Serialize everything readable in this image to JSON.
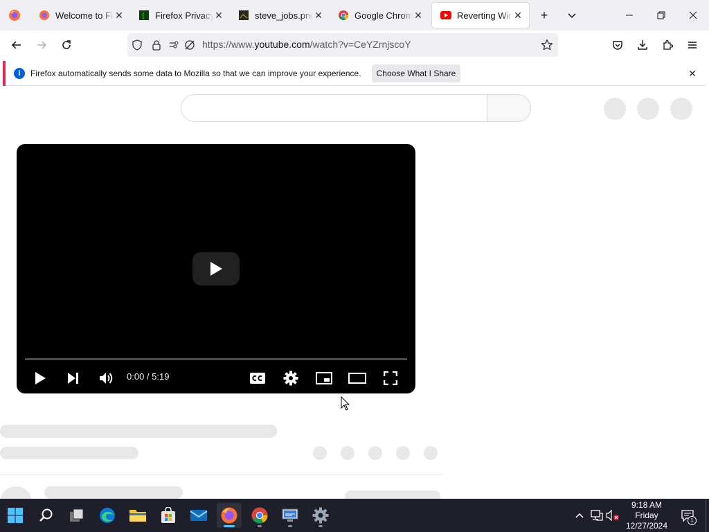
{
  "browser": {
    "tabs": [
      {
        "title": "Welcome to Firefox",
        "active": false
      },
      {
        "title": "Firefox Privacy Notice",
        "active": false
      },
      {
        "title": "steve_jobs.png",
        "active": false
      },
      {
        "title": "Google Chrome",
        "active": false
      },
      {
        "title": "Reverting Windows",
        "active": true
      }
    ],
    "url": {
      "prefix": "https://www.",
      "domain": "youtube.com",
      "path": "/watch?v=CeYZrnjscoY"
    }
  },
  "notification": {
    "message": "Firefox automatically sends some data to Mozilla so that we can improve your experience.",
    "action_label": "Choose What I Share",
    "info_glyph": "i"
  },
  "player": {
    "time": "0:00 / 5:19",
    "progress": 0
  },
  "taskbar": {
    "clock": {
      "time": "9:18 AM",
      "day": "Friday",
      "date": "12/27/2024"
    },
    "notification_count": "1"
  },
  "colors": {
    "accent_notice": "#e22850",
    "info_blue": "#0060df",
    "youtube_red": "#ff0000",
    "taskbar": "#1f1f2b"
  }
}
